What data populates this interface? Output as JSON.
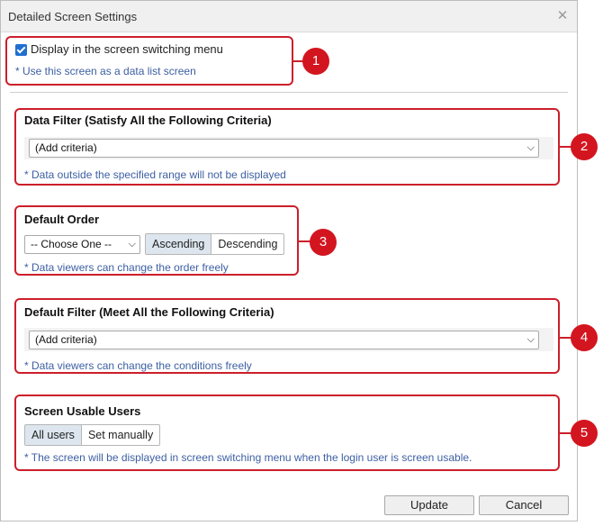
{
  "dialog": {
    "title": "Detailed Screen Settings",
    "close_glyph": "✕"
  },
  "section1": {
    "checkbox_label": "Display in the screen switching menu",
    "checked": true,
    "hint": "* Use this screen as a data list screen",
    "badge": "1"
  },
  "section2": {
    "title": "Data Filter (Satisfy All the Following Criteria)",
    "select_value": "(Add criteria)",
    "hint": "* Data outside the specified range will not be displayed",
    "badge": "2"
  },
  "section3": {
    "title": "Default Order",
    "select_value": "-- Choose One --",
    "ascending_label": "Ascending",
    "descending_label": "Descending",
    "selected": "Ascending",
    "hint": "* Data viewers can change the order freely",
    "badge": "3"
  },
  "section4": {
    "title": "Default Filter (Meet All the Following Criteria)",
    "select_value": "(Add criteria)",
    "hint": "* Data viewers can change the conditions freely",
    "badge": "4"
  },
  "section5": {
    "title": "Screen Usable Users",
    "all_users_label": "All users",
    "set_manually_label": "Set manually",
    "selected": "All users",
    "hint": "* The screen will be displayed in screen switching menu when the login user is screen usable.",
    "badge": "5"
  },
  "footer": {
    "update_label": "Update",
    "cancel_label": "Cancel"
  },
  "colors": {
    "accent_red": "#d3151f",
    "hint_blue": "#3d5fa3",
    "checkbox_blue": "#1f6fd1",
    "segment_active": "#dde6ef"
  }
}
